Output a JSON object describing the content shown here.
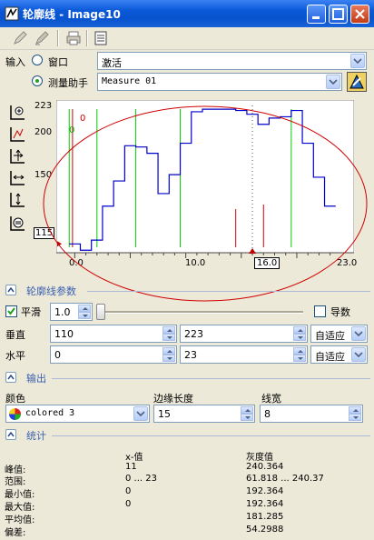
{
  "window": {
    "title": "轮廓线 - Image10"
  },
  "input": {
    "label": "输入",
    "window_option": "窗口",
    "window_value": "激活",
    "measure_option": "测量助手",
    "measure_value": "Measure 01"
  },
  "plot": {
    "y_ticks": [
      "223",
      "200",
      "150"
    ],
    "y_min_label": "115",
    "x_ticks": [
      "0.0",
      "10.0",
      "23.0"
    ],
    "x_current_label": "16.0",
    "labels_0": [
      "0",
      "0"
    ],
    "chart_data": {
      "type": "line",
      "x_range": [
        -1.5,
        24.5
      ],
      "y_range": [
        108,
        225
      ],
      "profile": {
        "x": [
          -0.5,
          0.5,
          0.5,
          1.5,
          1.5,
          2.5,
          2.5,
          3.5,
          3.5,
          4.5,
          4.5,
          5.5,
          5.5,
          6.5,
          6.5,
          7.5,
          7.5,
          8.5,
          8.5,
          9.5,
          9.5,
          10.5,
          10.5,
          11.5,
          11.5,
          12.5,
          12.5,
          13.5,
          13.5,
          14.5,
          14.5,
          15.5,
          15.5,
          16.5,
          16.5,
          17.5,
          17.5,
          18.5,
          18.5,
          19.5,
          19.5,
          20.5,
          20.5,
          21.5,
          21.5,
          22.5,
          22.5,
          23.5
        ],
        "y": [
          115,
          115,
          110,
          110,
          118,
          118,
          145,
          145,
          165,
          165,
          193,
          193,
          192,
          192,
          187,
          187,
          155,
          155,
          170,
          170,
          195,
          195,
          220,
          220,
          222,
          222,
          222,
          222,
          222,
          222,
          221,
          221,
          218,
          218,
          210,
          210,
          215,
          215,
          216,
          216,
          221,
          221,
          195,
          195,
          168,
          168,
          145,
          145
        ]
      },
      "green_lines_x": [
        -0.5,
        2.0,
        5.5,
        9.5,
        19.5
      ],
      "red_lines_x": [
        -0.2,
        14.5,
        17.0
      ],
      "current_x": 16.0
    }
  },
  "side_icons": [
    "zoom-in-icon",
    "fit-icon",
    "zoom-both-icon",
    "zoom-horizontal-icon",
    "zoom-vertical-icon",
    "center-icon"
  ],
  "profile_params": {
    "section_title": "轮廓线参数",
    "smooth_label": "平滑",
    "smooth_value": "1.0",
    "derivative_label": "导数",
    "vertical_label": "垂直",
    "vertical_min": "110",
    "vertical_max": "223",
    "vertical_mode": "自适应",
    "horizontal_label": "水平",
    "horizontal_min": "0",
    "horizontal_max": "23",
    "horizontal_mode": "自适应"
  },
  "output": {
    "section_title": "输出",
    "color_label": "颜色",
    "color_value": "colored 3",
    "edge_length_label": "边缘长度",
    "edge_length_value": "15",
    "line_width_label": "线宽",
    "line_width_value": "8"
  },
  "stats": {
    "section_title": "统计",
    "col_x": "x-值",
    "col_gray": "灰度值",
    "rows": [
      {
        "label": "峰值:",
        "x": "11",
        "gray": "240.364"
      },
      {
        "label": "范围:",
        "x": "0 ... 23",
        "gray": "61.818 ... 240.37"
      },
      {
        "label": "最小值:",
        "x": "0",
        "gray": "192.364"
      },
      {
        "label": "最大值:",
        "x": "0",
        "gray": "192.364"
      },
      {
        "label": "平均值:",
        "x": "",
        "gray": "181.285"
      },
      {
        "label": "偏差:",
        "x": "",
        "gray": "54.2988"
      }
    ]
  },
  "colors": {
    "profile_line": "#0000cc",
    "green_lines": "#00cc00",
    "red_lines": "#d00000",
    "annotation_ellipse": "#d00000",
    "section_title": "#3a5fb0"
  }
}
